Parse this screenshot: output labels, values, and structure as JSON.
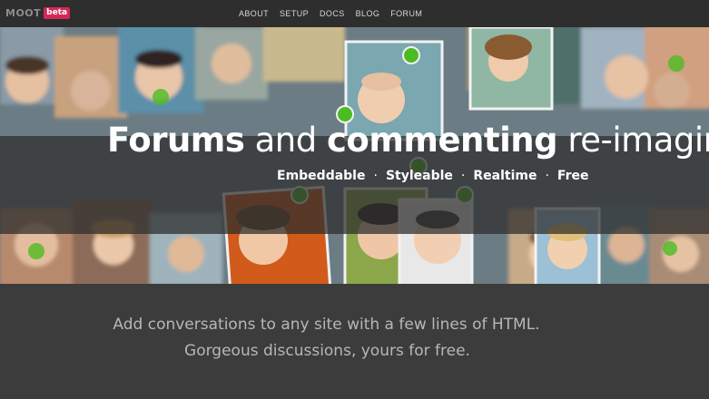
{
  "brand": {
    "name": "MOOT",
    "badge": "beta"
  },
  "nav": {
    "items": [
      "ABOUT",
      "SETUP",
      "DOCS",
      "BLOG",
      "FORUM"
    ]
  },
  "hero": {
    "headline_bold1": "Forums",
    "headline_mid": " and ",
    "headline_bold2": "commenting",
    "headline_end": " re-imagin",
    "features": [
      "Embeddable",
      "Styleable",
      "Realtime",
      "Free"
    ],
    "separator": "·"
  },
  "tagline": {
    "line1": "Add conversations to any site with a few lines of HTML.",
    "line2": "Gorgeous discussions, yours for free."
  },
  "colors": {
    "accent": "#d22a58",
    "nav_bg": "#2e2e2e",
    "page_bg": "#3c3c3c",
    "online": "#4dbb22"
  }
}
